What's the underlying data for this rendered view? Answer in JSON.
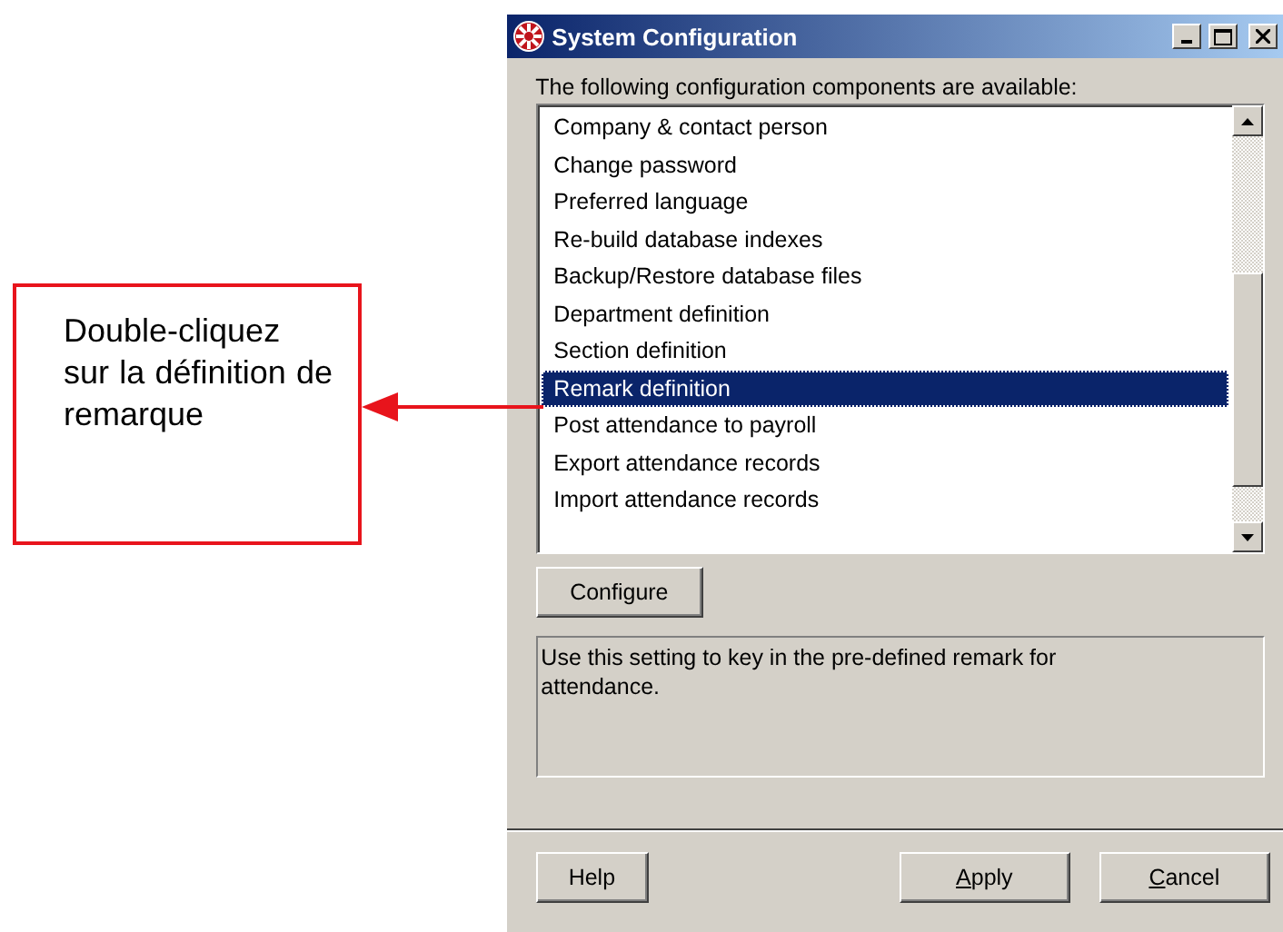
{
  "annotation": {
    "text": "Double-cliquez sur la définition de remarque"
  },
  "window": {
    "title": "System Configuration"
  },
  "list_label": "The following configuration components are available:",
  "components": [
    {
      "label": "Company & contact person",
      "selected": false
    },
    {
      "label": "Change password",
      "selected": false
    },
    {
      "label": "Preferred language",
      "selected": false
    },
    {
      "label": "Re-build database indexes",
      "selected": false
    },
    {
      "label": "Backup/Restore database files",
      "selected": false
    },
    {
      "label": "Department definition",
      "selected": false
    },
    {
      "label": "Section definition",
      "selected": false
    },
    {
      "label": "Remark definition",
      "selected": true
    },
    {
      "label": "Post attendance to payroll",
      "selected": false
    },
    {
      "label": "Export attendance records",
      "selected": false
    },
    {
      "label": "Import attendance records",
      "selected": false
    }
  ],
  "configure_button": "Configure",
  "description": "Use this setting to key in the pre-defined remark for attendance.",
  "buttons": [
    {
      "label": "Help",
      "mnemonic": false
    },
    {
      "label": "Apply",
      "mnemonic": true
    },
    {
      "label": "Cancel",
      "mnemonic": true
    }
  ]
}
